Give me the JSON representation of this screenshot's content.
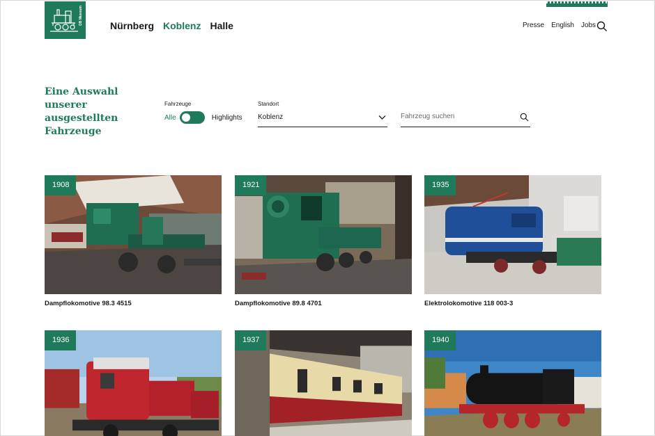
{
  "brand": {
    "logo_text": "DB Museum"
  },
  "cities": [
    {
      "label": "Nürnberg",
      "active": false
    },
    {
      "label": "Koblenz",
      "active": true
    },
    {
      "label": "Halle",
      "active": false
    }
  ],
  "topnav": {
    "presse": "Presse",
    "english": "English",
    "jobs": "Jobs"
  },
  "headline": "Eine Auswahl unserer ausgestellten Fahrzeuge",
  "filters": {
    "fahrzeuge_label": "Fahrzeuge",
    "option_all": "Alle",
    "option_highlights": "Highlights",
    "toggle_state": "Alle",
    "standort_label": "Standort",
    "standort_value": "Koblenz",
    "search_placeholder": "Fahrzeug suchen",
    "search_value": ""
  },
  "vehicles": [
    {
      "year": "1908",
      "title": "Dampflokomotive 98.3 4515"
    },
    {
      "year": "1921",
      "title": "Dampflokomotive 89.8 4701"
    },
    {
      "year": "1935",
      "title": "Elektrolokomotive 118 003-3"
    },
    {
      "year": "1936",
      "title": ""
    },
    {
      "year": "1937",
      "title": ""
    },
    {
      "year": "1940",
      "title": ""
    }
  ],
  "colors": {
    "accent": "#1f7a5b",
    "text": "#1a1a1a"
  }
}
